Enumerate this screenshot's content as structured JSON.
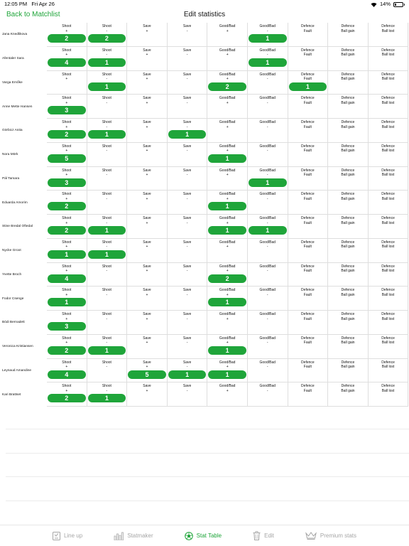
{
  "status": {
    "time": "12:05 PM",
    "date": "Fri Apr 26",
    "battery": "14%",
    "battery_level": 0.14
  },
  "nav": {
    "back_label": "Back to Matchlist",
    "title": "Edit statistics"
  },
  "columns": [
    {
      "line1": "Shoot",
      "line2": "+"
    },
    {
      "line1": "Shoot",
      "line2": "-"
    },
    {
      "line1": "Save",
      "line2": "+"
    },
    {
      "line1": "Save",
      "line2": "-"
    },
    {
      "line1": "Good/Bad",
      "line2": "+"
    },
    {
      "line1": "Good/Bad",
      "line2": "-"
    },
    {
      "line1": "Defence",
      "line2": "Fault"
    },
    {
      "line1": "Defence",
      "line2": "Ball gain"
    },
    {
      "line1": "Defence",
      "line2": "Ball lost"
    }
  ],
  "players": [
    {
      "name": "Jana Knedlikova",
      "values": [
        "2",
        "2",
        "",
        "",
        "",
        "1",
        "",
        "",
        ""
      ]
    },
    {
      "name": "Afentaler Sara",
      "values": [
        "4",
        "1",
        "",
        "",
        "",
        "1",
        "",
        "",
        ""
      ]
    },
    {
      "name": "Varga Emőke",
      "values": [
        "",
        "1",
        "",
        "",
        "2",
        "",
        "1",
        "",
        ""
      ]
    },
    {
      "name": "Anne Mette Hansen",
      "values": [
        "3",
        "",
        "",
        "",
        "",
        "",
        "",
        "",
        ""
      ]
    },
    {
      "name": "Görbicz Anita",
      "values": [
        "2",
        "1",
        "",
        "1",
        "",
        "",
        "",
        "",
        ""
      ]
    },
    {
      "name": "Nora Mörk",
      "values": [
        "5",
        "",
        "",
        "",
        "1",
        "",
        "",
        "",
        ""
      ]
    },
    {
      "name": "Pál Tamara",
      "values": [
        "3",
        "",
        "",
        "",
        "",
        "1",
        "",
        "",
        ""
      ]
    },
    {
      "name": "Eduarda Amorim",
      "values": [
        "2",
        "",
        "",
        "",
        "1",
        "",
        "",
        "",
        ""
      ]
    },
    {
      "name": "Stine Bredal Oftedal",
      "values": [
        "2",
        "1",
        "",
        "",
        "1",
        "1",
        "",
        "",
        ""
      ]
    },
    {
      "name": "Nycke Groot",
      "values": [
        "1",
        "1",
        "",
        "",
        "",
        "",
        "",
        "",
        ""
      ]
    },
    {
      "name": "Yvette Broch",
      "values": [
        "4",
        "",
        "",
        "",
        "2",
        "",
        "",
        "",
        ""
      ]
    },
    {
      "name": "Fodor Csenge",
      "values": [
        "1",
        "",
        "",
        "",
        "1",
        "",
        "",
        "",
        ""
      ]
    },
    {
      "name": "Bódi Bernadett",
      "values": [
        "3",
        "",
        "",
        "",
        "",
        "",
        "",
        "",
        ""
      ]
    },
    {
      "name": "Veronica Kristiansen",
      "values": [
        "2",
        "1",
        "",
        "",
        "1",
        "",
        "",
        "",
        ""
      ]
    },
    {
      "name": "Leynaud Amandine",
      "values": [
        "4",
        "",
        "5",
        "1",
        "1",
        "",
        "",
        "",
        ""
      ]
    },
    {
      "name": "Kari Brattset",
      "values": [
        "2",
        "1",
        "",
        "",
        "",
        "",
        "",
        "",
        ""
      ]
    }
  ],
  "tabbar": {
    "items": [
      {
        "label": "Line up",
        "icon": "lineup-icon",
        "active": false
      },
      {
        "label": "Statmaker",
        "icon": "chart-icon",
        "active": false
      },
      {
        "label": "Stat Table",
        "icon": "ball-icon",
        "active": true
      },
      {
        "label": "Edit",
        "icon": "trash-icon",
        "active": false
      },
      {
        "label": "Premium stats",
        "icon": "crown-icon",
        "active": false
      }
    ]
  },
  "colors": {
    "accent": "#1fa53a",
    "inactive": "#a6a6a6"
  }
}
